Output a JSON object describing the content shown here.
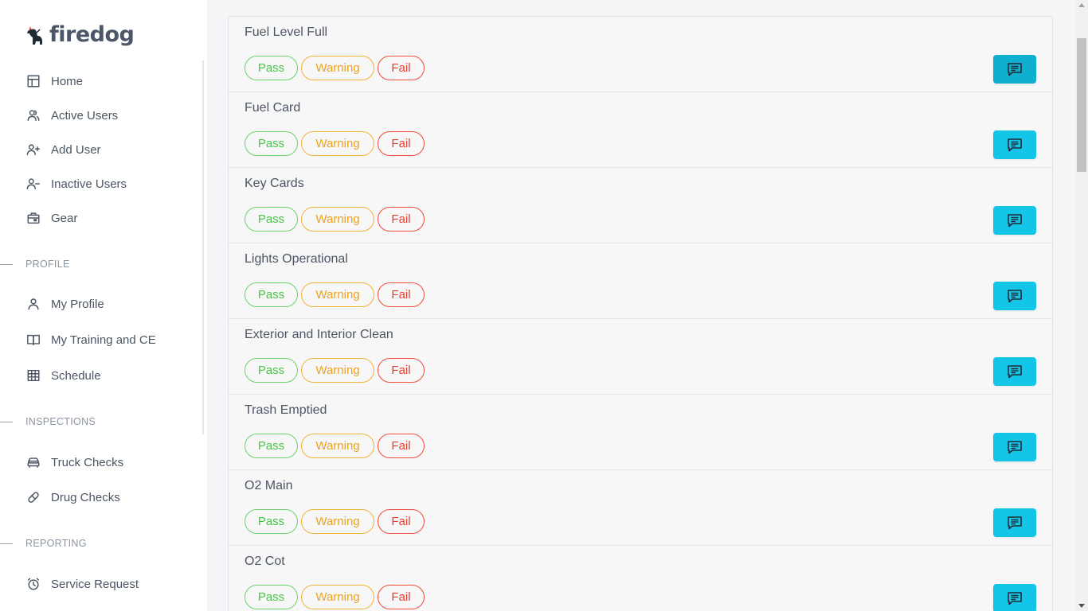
{
  "app": {
    "logo_text": "firedog"
  },
  "sidebar": {
    "main_items": [
      {
        "label": "Home",
        "icon": "layout-icon"
      },
      {
        "label": "Active Users",
        "icon": "users-icon"
      },
      {
        "label": "Add User",
        "icon": "user-plus-icon"
      },
      {
        "label": "Inactive Users",
        "icon": "user-minus-icon"
      },
      {
        "label": "Gear",
        "icon": "toolbox-icon"
      }
    ],
    "profile_section": {
      "title": "PROFILE",
      "items": [
        {
          "label": "My Profile",
          "icon": "user-icon"
        },
        {
          "label": "My Training and CE",
          "icon": "book-icon"
        },
        {
          "label": "Schedule",
          "icon": "grid-icon"
        }
      ]
    },
    "inspections_section": {
      "title": "INSPECTIONS",
      "items": [
        {
          "label": "Truck Checks",
          "icon": "car-icon"
        },
        {
          "label": "Drug Checks",
          "icon": "pill-icon"
        }
      ]
    },
    "reporting_section": {
      "title": "REPORTING",
      "items": [
        {
          "label": "Service Request",
          "icon": "alarm-clock-icon"
        }
      ]
    }
  },
  "buttons": {
    "pass": "Pass",
    "warning": "Warning",
    "fail": "Fail"
  },
  "checklist": [
    {
      "title": "Fuel Level Full"
    },
    {
      "title": "Fuel Card"
    },
    {
      "title": "Key Cards"
    },
    {
      "title": "Lights Operational"
    },
    {
      "title": "Exterior and Interior Clean"
    },
    {
      "title": "Trash Emptied"
    },
    {
      "title": "O2 Main"
    },
    {
      "title": "O2 Cot"
    }
  ],
  "colors": {
    "pass": "#47c547",
    "warning": "#eea21a",
    "fail": "#e8402f",
    "comment_button": "#13c6e8"
  }
}
